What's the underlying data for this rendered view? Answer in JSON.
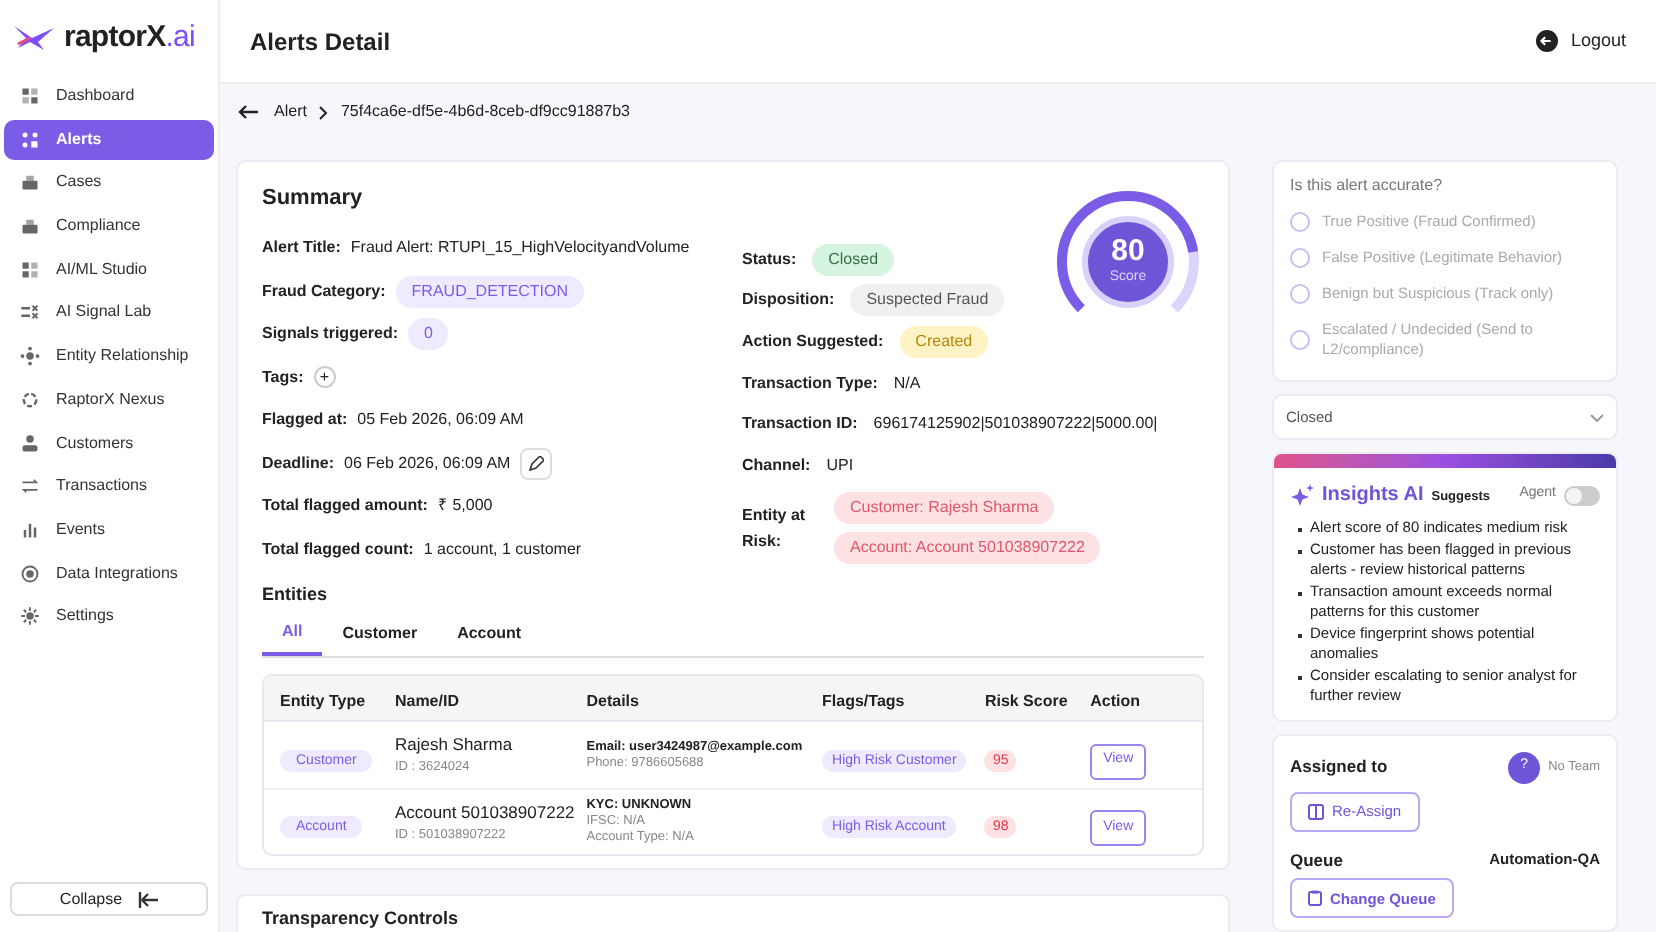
{
  "brand": {
    "name": "raptorX",
    "suffix": ".ai"
  },
  "sidebar": {
    "items": [
      {
        "label": "Dashboard",
        "selected": false
      },
      {
        "label": "Alerts",
        "selected": true
      },
      {
        "label": "Cases",
        "selected": false
      },
      {
        "label": "Compliance",
        "selected": false
      },
      {
        "label": "AI/ML Studio",
        "selected": false
      },
      {
        "label": "AI Signal Lab",
        "selected": false
      },
      {
        "label": "Entity Relationship",
        "selected": false
      },
      {
        "label": "RaptorX Nexus",
        "selected": false
      },
      {
        "label": "Customers",
        "selected": false
      },
      {
        "label": "Transactions",
        "selected": false
      },
      {
        "label": "Events",
        "selected": false
      },
      {
        "label": "Data Integrations",
        "selected": false
      },
      {
        "label": "Settings",
        "selected": false
      }
    ],
    "collapse_label": "Collapse"
  },
  "header": {
    "title": "Alerts Detail",
    "logout": "Logout"
  },
  "breadcrumb": [
    "Alert",
    "75f4ca6e-df5e-4b6d-8ceb-df9cc91887b3"
  ],
  "summary": {
    "title": "Summary",
    "left": [
      {
        "label": "Alert Title:",
        "value": "Fraud Alert: RTUPI_15_HighVelocityandVolume",
        "kind": "text"
      },
      {
        "label": "Fraud Category:",
        "value": "FRAUD_DETECTION",
        "kind": "chip"
      },
      {
        "label": "Signals triggered:",
        "value": "0",
        "kind": "chip"
      },
      {
        "label": "Tags:",
        "value": "+",
        "kind": "add"
      },
      {
        "label": "Flagged at:",
        "value": "05 Feb 2026, 06:09 AM",
        "kind": "text"
      },
      {
        "label": "Deadline:",
        "value": "06 Feb 2026, 06:09 AM",
        "kind": "edit"
      },
      {
        "label": "Total flagged amount:",
        "value": "₹ 5,000",
        "kind": "text"
      },
      {
        "label": "Total flagged count:",
        "value": "1 account, 1 customer",
        "kind": "text"
      }
    ],
    "right": [
      {
        "label": "Status:",
        "value": "Closed",
        "kind": "green"
      },
      {
        "label": "Disposition:",
        "value": "Suspected Fraud",
        "kind": "gray"
      },
      {
        "label": "Action Suggested:",
        "value": "Created",
        "kind": "yellow"
      },
      {
        "label": "Transaction Type:",
        "value": "N/A",
        "kind": "text"
      },
      {
        "label": "Transaction ID:",
        "value": "696174125902|501038907222|5000.00|",
        "kind": "text"
      },
      {
        "label": "Channel:",
        "value": "UPI",
        "kind": "text"
      }
    ],
    "entity_at_risk": {
      "label": "Entity at Risk:",
      "items": [
        "Customer: Rajesh Sharma",
        "Account: Account 501038907222"
      ]
    },
    "score": {
      "value": "80",
      "label": "Score",
      "level": 0.8
    }
  },
  "entities": {
    "title": "Entities",
    "tabs": [
      {
        "label": "All",
        "selected": true
      },
      {
        "label": "Customer",
        "selected": false
      },
      {
        "label": "Account",
        "selected": false
      }
    ],
    "columns": [
      "Entity Type",
      "Name/ID",
      "Details",
      "Flags/Tags",
      "Risk Score",
      "Action"
    ],
    "rows": [
      {
        "type": "Customer",
        "name": "Rajesh Sharma",
        "id": "ID : 3624024",
        "details": [
          "Email: user3424987@example.com",
          "Phone: 9786605688"
        ],
        "flag": "High Risk Customer",
        "risk": "95",
        "action": "View"
      },
      {
        "type": "Account",
        "name": "Account 501038907222",
        "id": "ID : 501038907222",
        "details": [
          "KYC: UNKNOWN",
          "IFSC: N/A",
          "Account Type: N/A"
        ],
        "flag": "High Risk Account",
        "risk": "98",
        "action": "View"
      }
    ]
  },
  "transparency": {
    "title": "Transparency Controls"
  },
  "feedback": {
    "question": "Is this alert accurate?",
    "options": [
      {
        "label": "True Positive (Fraud Confirmed)",
        "selected": false
      },
      {
        "label": "False Positive (Legitimate Behavior)",
        "selected": false
      },
      {
        "label": "Benign but Suspicious (Track only)",
        "selected": false
      },
      {
        "label": "Escalated / Undecided (Send to L2/compliance)",
        "selected": false
      }
    ],
    "disabled": true
  },
  "status_select": {
    "value": "Closed"
  },
  "insights": {
    "title": "Insights AI",
    "subtitle": "Suggests",
    "agent_label": "Agent",
    "agent_on": false,
    "points": [
      "Alert score of 80 indicates medium risk",
      "Customer has been flagged in previous alerts - review historical patterns",
      "Transaction amount exceeds normal patterns for this customer",
      "Device fingerprint shows potential anomalies",
      "Consider escalating to senior analyst for further review"
    ]
  },
  "assignment": {
    "title": "Assigned to",
    "avatar": "?",
    "team": "No Team",
    "reassign": "Re-Assign",
    "queue_title": "Queue",
    "queue": "Automation-QA",
    "change_queue": "Change Queue"
  }
}
